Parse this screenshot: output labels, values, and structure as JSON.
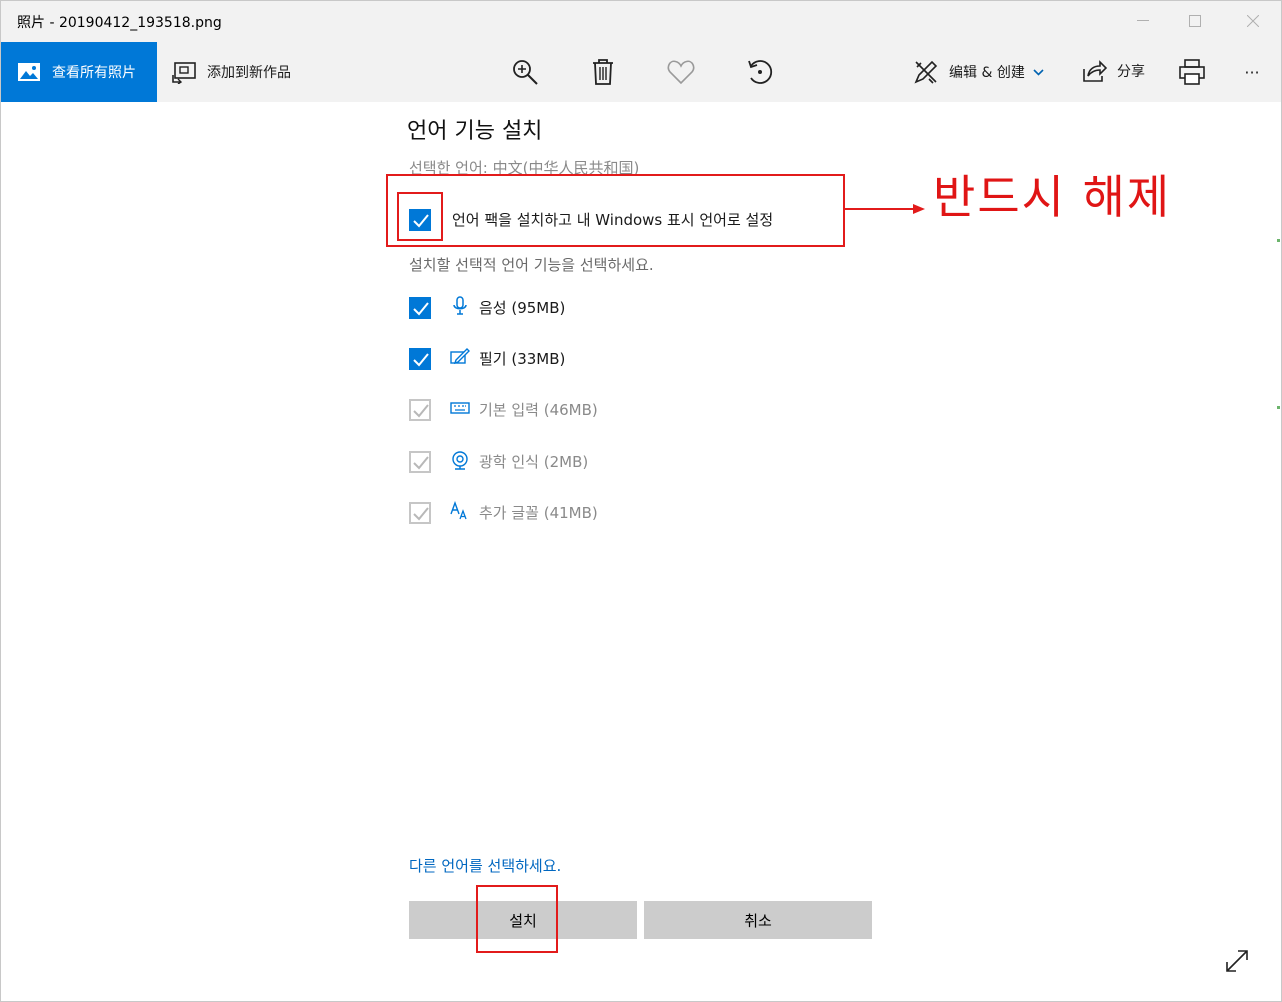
{
  "window": {
    "title": "照片 - 20190412_193518.png"
  },
  "toolbar": {
    "view_all_label": "查看所有照片",
    "add_creation_label": "添加到新作品",
    "edit_create_label": "编辑 & 创建",
    "share_label": "分享",
    "more_label": "···",
    "icons": [
      "zoom-in-icon",
      "delete-icon",
      "favorite-icon",
      "rotate-icon",
      "print-icon"
    ]
  },
  "dialog": {
    "title": "언어 기능 설치",
    "selected_language": "선택한 언어: 中文(中华人民共和国)",
    "set_display_language": {
      "label": "언어 팩을 설치하고 내 Windows 표시 언어로 설정",
      "checked": true
    },
    "optional_hint": "설치할 선택적 언어 기능을 선택하세요.",
    "features": [
      {
        "label": "음성 (95MB)",
        "checked": true,
        "enabled": true,
        "icon": "microphone-icon"
      },
      {
        "label": "필기 (33MB)",
        "checked": true,
        "enabled": true,
        "icon": "pen-icon"
      },
      {
        "label": "기본 입력 (46MB)",
        "checked": true,
        "enabled": false,
        "icon": "keyboard-icon"
      },
      {
        "label": "광학 인식 (2MB)",
        "checked": true,
        "enabled": false,
        "icon": "camera-icon"
      },
      {
        "label": "추가 글꼴 (41MB)",
        "checked": true,
        "enabled": false,
        "icon": "font-icon"
      }
    ],
    "choose_other_link": "다른 언어를 선택하세요.",
    "install_button": "설치",
    "cancel_button": "취소"
  },
  "annotation": {
    "text": "반드시 해제",
    "color": "#e21b1b"
  },
  "colors": {
    "accent": "#0078d7",
    "link": "#0067c0",
    "toolbar_bg": "#f2f2f2",
    "button_bg": "#cccccc"
  }
}
